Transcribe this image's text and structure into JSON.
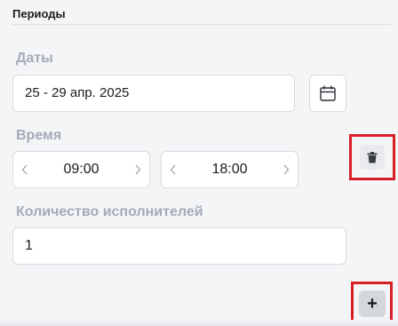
{
  "section": {
    "title": "Периоды"
  },
  "dates": {
    "label": "Даты",
    "value": "25 - 29 апр. 2025",
    "calendar_icon": "calendar-icon"
  },
  "time": {
    "label": "Время",
    "start": "09:00",
    "end": "18:00",
    "prev_icon": "chevron-left-icon",
    "next_icon": "chevron-right-icon",
    "delete_icon": "trash-icon"
  },
  "performers": {
    "label": "Количество исполнителей",
    "value": "1"
  },
  "actions": {
    "add_label": "+"
  },
  "colors": {
    "highlight": "#d81f26",
    "label": "#a3abb8",
    "border": "#d7dbe0"
  }
}
